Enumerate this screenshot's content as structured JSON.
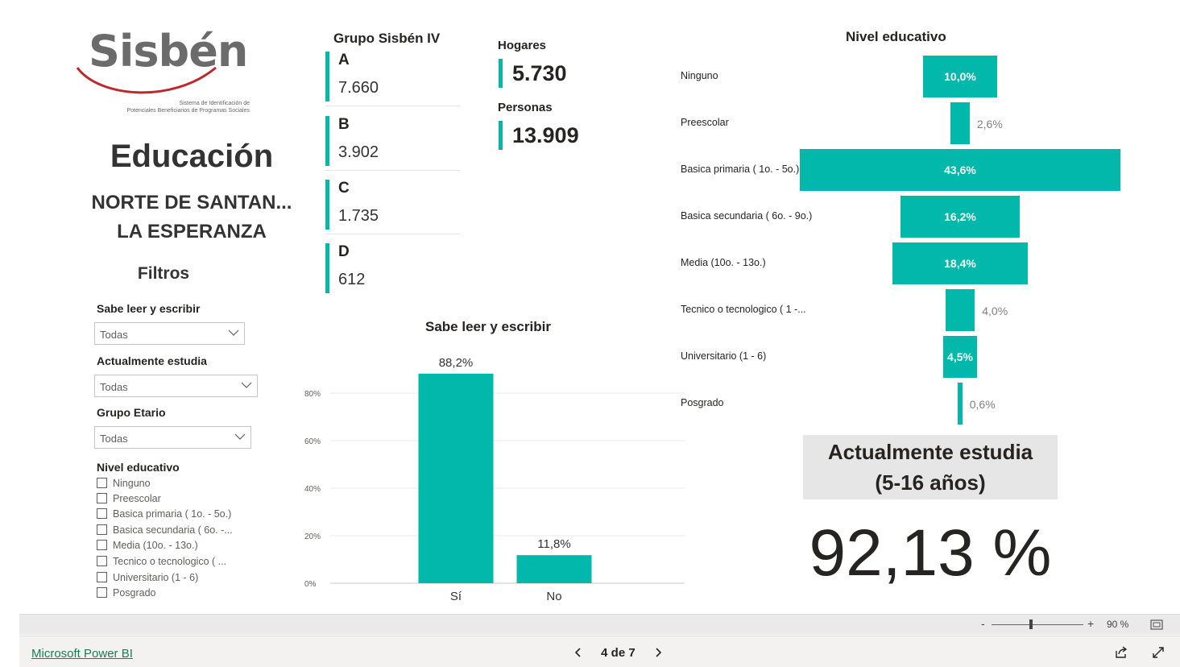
{
  "logo": {
    "word": "Sisbén",
    "subtitle_line1": "Sistema de Identificación de",
    "subtitle_line2": "Potenciales Beneficiarios de Programas Sociales"
  },
  "header": {
    "title": "Educación",
    "department": "NORTE DE SANTAN...",
    "municipality": "LA ESPERANZA"
  },
  "filters": {
    "heading": "Filtros",
    "sabe_leer": {
      "label": "Sabe leer y escribir",
      "value": "Todas"
    },
    "estudia": {
      "label": "Actualmente estudia",
      "value": "Todas"
    },
    "grupo_etario": {
      "label": "Grupo Etario",
      "value": "Todas"
    },
    "nivel": {
      "label": "Nivel educativo",
      "options": [
        "Ninguno",
        "Preescolar",
        "Basica primaria ( 1o. - 5o.)",
        "Basica secundaria ( 6o. -...",
        "Media (10o. - 13o.)",
        "Tecnico o tecnologico ( ...",
        "Universitario (1 - 6)",
        "Posgrado"
      ]
    }
  },
  "grupo_sisben": {
    "title": "Grupo Sisbén IV",
    "groups": [
      {
        "letter": "A",
        "value": "7.660"
      },
      {
        "letter": "B",
        "value": "3.902"
      },
      {
        "letter": "C",
        "value": "1.735"
      },
      {
        "letter": "D",
        "value": "612"
      }
    ]
  },
  "kpis": {
    "hogares_label": "Hogares",
    "hogares_value": "5.730",
    "personas_label": "Personas",
    "personas_value": "13.909"
  },
  "funnel": {
    "title": "Nivel educativo",
    "rows": [
      {
        "label": "Ninguno",
        "value": 10.0,
        "text": "10,0%",
        "inside": true
      },
      {
        "label": "Preescolar",
        "value": 2.6,
        "text": "2,6%",
        "inside": false
      },
      {
        "label": "Basica primaria ( 1o. - 5o.)",
        "value": 43.6,
        "text": "43,6%",
        "inside": true
      },
      {
        "label": "Basica secundaria ( 6o. - 9o.)",
        "value": 16.2,
        "text": "16,2%",
        "inside": true
      },
      {
        "label": "Media (10o. - 13o.)",
        "value": 18.4,
        "text": "18,4%",
        "inside": true
      },
      {
        "label": "Tecnico o tecnologico ( 1 -...",
        "value": 4.0,
        "text": "4,0%",
        "inside": false
      },
      {
        "label": "Universitario (1 - 6)",
        "value": 4.5,
        "text": "4,5%",
        "inside": true
      },
      {
        "label": "Posgrado",
        "value": 0.6,
        "text": "0,6%",
        "inside": false
      }
    ]
  },
  "chart_data": {
    "type": "bar",
    "title": "Sabe leer y escribir",
    "categories": [
      "Sí",
      "No"
    ],
    "values": [
      88.2,
      11.8
    ],
    "value_labels": [
      "88,2%",
      "11,8%"
    ],
    "yticks": [
      "0%",
      "20%",
      "40%",
      "60%",
      "80%"
    ],
    "ylim": [
      0,
      100
    ],
    "grid": true,
    "color": "#01b8aa"
  },
  "estudia_card": {
    "line1": "Actualmente estudia",
    "line2": "(5-16 años)",
    "value": "92,13 %"
  },
  "zoom": {
    "minus": "-",
    "plus": "+",
    "level": "90 %"
  },
  "footer": {
    "link": "Microsoft Power BI",
    "page": "4 de 7"
  },
  "colors": {
    "accent": "#01b8aa",
    "logo_red": "#c0272d",
    "link": "#177d56"
  }
}
